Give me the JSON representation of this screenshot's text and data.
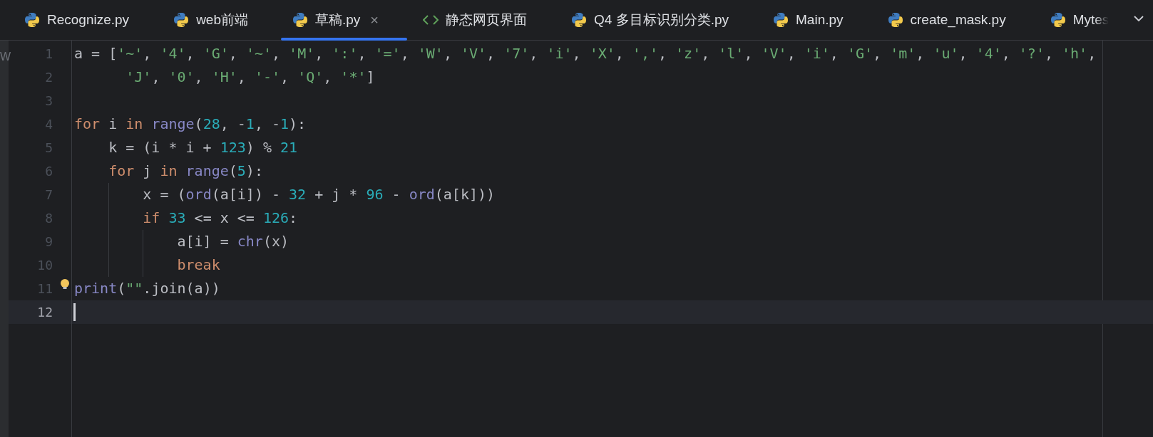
{
  "side_panel_fragment": "W",
  "tabs": [
    {
      "label": "Recognize.py",
      "kind": "python",
      "selected": false
    },
    {
      "label": "web前端",
      "kind": "python",
      "selected": false
    },
    {
      "label": "草稿.py",
      "kind": "python",
      "selected": true,
      "close": "×"
    },
    {
      "label": "静态网页界面",
      "kind": "html",
      "selected": false
    },
    {
      "label": "Q4 多目标识别分类.py",
      "kind": "python",
      "selected": false
    },
    {
      "label": "Main.py",
      "kind": "python",
      "selected": false
    },
    {
      "label": "create_mask.py",
      "kind": "python",
      "selected": false
    },
    {
      "label": "Mytes",
      "kind": "python",
      "selected": false,
      "cut": true
    }
  ],
  "editor": {
    "lines": [
      {
        "number": "1",
        "current": false,
        "tokens": [
          {
            "text": "a = [",
            "kind": "plain"
          },
          {
            "text": "'~'",
            "kind": "string"
          },
          {
            "text": ", ",
            "kind": "plain"
          },
          {
            "text": "'4'",
            "kind": "string"
          },
          {
            "text": ", ",
            "kind": "plain"
          },
          {
            "text": "'G'",
            "kind": "string"
          },
          {
            "text": ", ",
            "kind": "plain"
          },
          {
            "text": "'~'",
            "kind": "string"
          },
          {
            "text": ", ",
            "kind": "plain"
          },
          {
            "text": "'M'",
            "kind": "string"
          },
          {
            "text": ", ",
            "kind": "plain"
          },
          {
            "text": "':'",
            "kind": "string"
          },
          {
            "text": ", ",
            "kind": "plain"
          },
          {
            "text": "'='",
            "kind": "string"
          },
          {
            "text": ", ",
            "kind": "plain"
          },
          {
            "text": "'W'",
            "kind": "string"
          },
          {
            "text": ", ",
            "kind": "plain"
          },
          {
            "text": "'V'",
            "kind": "string"
          },
          {
            "text": ", ",
            "kind": "plain"
          },
          {
            "text": "'7'",
            "kind": "string"
          },
          {
            "text": ", ",
            "kind": "plain"
          },
          {
            "text": "'i'",
            "kind": "string"
          },
          {
            "text": ", ",
            "kind": "plain"
          },
          {
            "text": "'X'",
            "kind": "string"
          },
          {
            "text": ", ",
            "kind": "plain"
          },
          {
            "text": "','",
            "kind": "string"
          },
          {
            "text": ", ",
            "kind": "plain"
          },
          {
            "text": "'z'",
            "kind": "string"
          },
          {
            "text": ", ",
            "kind": "plain"
          },
          {
            "text": "'l'",
            "kind": "string"
          },
          {
            "text": ", ",
            "kind": "plain"
          },
          {
            "text": "'V'",
            "kind": "string"
          },
          {
            "text": ", ",
            "kind": "plain"
          },
          {
            "text": "'i'",
            "kind": "string"
          },
          {
            "text": ", ",
            "kind": "plain"
          },
          {
            "text": "'G'",
            "kind": "string"
          },
          {
            "text": ", ",
            "kind": "plain"
          },
          {
            "text": "'m'",
            "kind": "string"
          },
          {
            "text": ", ",
            "kind": "plain"
          },
          {
            "text": "'u'",
            "kind": "string"
          },
          {
            "text": ", ",
            "kind": "plain"
          },
          {
            "text": "'4'",
            "kind": "string"
          },
          {
            "text": ", ",
            "kind": "plain"
          },
          {
            "text": "'?'",
            "kind": "string"
          },
          {
            "text": ", ",
            "kind": "plain"
          },
          {
            "text": "'h'",
            "kind": "string"
          },
          {
            "text": ",",
            "kind": "plain"
          }
        ]
      },
      {
        "number": "2",
        "current": false,
        "tokens": [
          {
            "text": "      'J'",
            "kind": "string"
          },
          {
            "text": ", ",
            "kind": "plain"
          },
          {
            "text": "'0'",
            "kind": "string"
          },
          {
            "text": ", ",
            "kind": "plain"
          },
          {
            "text": "'H'",
            "kind": "string"
          },
          {
            "text": ", ",
            "kind": "plain"
          },
          {
            "text": "'-'",
            "kind": "string"
          },
          {
            "text": ", ",
            "kind": "plain"
          },
          {
            "text": "'Q'",
            "kind": "string"
          },
          {
            "text": ", ",
            "kind": "plain"
          },
          {
            "text": "'*'",
            "kind": "string"
          },
          {
            "text": "]",
            "kind": "plain"
          }
        ]
      },
      {
        "number": "3",
        "current": false
      },
      {
        "number": "4",
        "current": false,
        "tokens": [
          {
            "text": "for",
            "kind": "keyword"
          },
          {
            "text": " i ",
            "kind": "plain"
          },
          {
            "text": "in ",
            "kind": "keyword"
          },
          {
            "text": "range",
            "kind": "builtin"
          },
          {
            "text": "(",
            "kind": "plain"
          },
          {
            "text": "28",
            "kind": "number"
          },
          {
            "text": ", -",
            "kind": "plain"
          },
          {
            "text": "1",
            "kind": "number"
          },
          {
            "text": ", -",
            "kind": "plain"
          },
          {
            "text": "1",
            "kind": "number"
          },
          {
            "text": "):",
            "kind": "plain"
          }
        ]
      },
      {
        "number": "5",
        "current": false,
        "tokens": [
          {
            "text": "    k = (i * i + ",
            "kind": "plain"
          },
          {
            "text": "123",
            "kind": "number"
          },
          {
            "text": ") % ",
            "kind": "plain"
          },
          {
            "text": "21",
            "kind": "number"
          }
        ]
      },
      {
        "number": "6",
        "current": false,
        "tokens": [
          {
            "text": "    for",
            "kind": "keyword"
          },
          {
            "text": " j ",
            "kind": "plain"
          },
          {
            "text": "in ",
            "kind": "keyword"
          },
          {
            "text": "range",
            "kind": "builtin"
          },
          {
            "text": "(",
            "kind": "plain"
          },
          {
            "text": "5",
            "kind": "number"
          },
          {
            "text": "):",
            "kind": "plain"
          }
        ]
      },
      {
        "number": "7",
        "current": false,
        "tokens": [
          {
            "text": "        x = (",
            "kind": "plain"
          },
          {
            "text": "ord",
            "kind": "builtin"
          },
          {
            "text": "(a[i]) - ",
            "kind": "plain"
          },
          {
            "text": "32",
            "kind": "number"
          },
          {
            "text": " + j * ",
            "kind": "plain"
          },
          {
            "text": "96",
            "kind": "number"
          },
          {
            "text": " - ",
            "kind": "plain"
          },
          {
            "text": "ord",
            "kind": "builtin"
          },
          {
            "text": "(a[k]))",
            "kind": "plain"
          }
        ]
      },
      {
        "number": "8",
        "current": false,
        "tokens": [
          {
            "text": "        if ",
            "kind": "keyword"
          },
          {
            "text": "33",
            "kind": "number"
          },
          {
            "text": " <= x <= ",
            "kind": "plain"
          },
          {
            "text": "126",
            "kind": "number"
          },
          {
            "text": ":",
            "kind": "plain"
          }
        ]
      },
      {
        "number": "9",
        "current": false,
        "tokens": [
          {
            "text": "            a[i] = ",
            "kind": "plain"
          },
          {
            "text": "chr",
            "kind": "builtin"
          },
          {
            "text": "(x)",
            "kind": "plain"
          }
        ]
      },
      {
        "number": "10",
        "current": false,
        "tokens": [
          {
            "text": "            break",
            "kind": "keyword"
          }
        ]
      },
      {
        "number": "11",
        "current": false,
        "bulb": true,
        "tokens": [
          {
            "text": "print",
            "kind": "builtin"
          },
          {
            "text": "(",
            "kind": "plain"
          },
          {
            "text": "\"\"",
            "kind": "string"
          },
          {
            "text": ".join(a))",
            "kind": "plain"
          }
        ]
      },
      {
        "number": "12",
        "current": true
      }
    ]
  }
}
